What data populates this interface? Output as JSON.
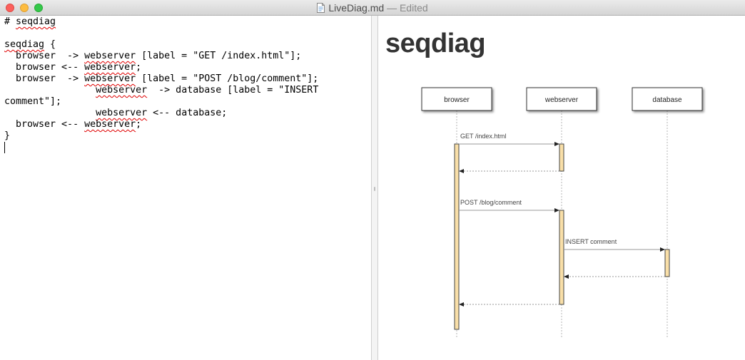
{
  "window": {
    "title": "LiveDiag.md",
    "separator": "—",
    "status": "Edited"
  },
  "editor": {
    "lines": [
      [
        {
          "t": "# "
        },
        {
          "t": "seqdiag",
          "spell": true
        }
      ],
      [],
      [
        {
          "t": "seqdiag",
          "spell": true
        },
        {
          "t": " {"
        }
      ],
      [
        {
          "t": "  browser  -> "
        },
        {
          "t": "webserver",
          "spell": true
        },
        {
          "t": " [label = \"GET /index.html\"];"
        }
      ],
      [
        {
          "t": "  browser <-- "
        },
        {
          "t": "webserver",
          "spell": true
        },
        {
          "t": ";"
        }
      ],
      [
        {
          "t": "  browser  -> "
        },
        {
          "t": "webserver",
          "spell": true
        },
        {
          "t": " [label = \"POST /blog/comment\"];"
        }
      ],
      [
        {
          "t": "                "
        },
        {
          "t": "webserver",
          "spell": true
        },
        {
          "t": "  -> database [label = \"INSERT"
        }
      ],
      [
        {
          "t": "comment\"];"
        }
      ],
      [
        {
          "t": "                "
        },
        {
          "t": "webserver",
          "spell": true
        },
        {
          "t": " <-- database;"
        }
      ],
      [
        {
          "t": "  browser <-- "
        },
        {
          "t": "webserver",
          "spell": true
        },
        {
          "t": ";"
        }
      ],
      [
        {
          "t": "}"
        }
      ],
      [
        {
          "caret": true
        }
      ]
    ]
  },
  "preview": {
    "heading": "seqdiag",
    "diagram": {
      "actors": [
        "browser",
        "webserver",
        "database"
      ],
      "messages": [
        {
          "from": 0,
          "to": 1,
          "label": "GET /index.html",
          "kind": "call"
        },
        {
          "from": 1,
          "to": 0,
          "label": "",
          "kind": "return"
        },
        {
          "from": 0,
          "to": 1,
          "label": "POST /blog/comment",
          "kind": "call"
        },
        {
          "from": 1,
          "to": 2,
          "label": "INSERT comment",
          "kind": "call"
        },
        {
          "from": 2,
          "to": 1,
          "label": "",
          "kind": "return"
        },
        {
          "from": 1,
          "to": 0,
          "label": "",
          "kind": "return"
        }
      ],
      "colors": {
        "activation_fill": "#f9dfa8",
        "activation_stroke": "#444444",
        "arrow": "#999999",
        "text": "#444444"
      }
    }
  },
  "icons": [
    "document-icon",
    "close-window-icon",
    "minimize-window-icon",
    "zoom-window-icon"
  ]
}
